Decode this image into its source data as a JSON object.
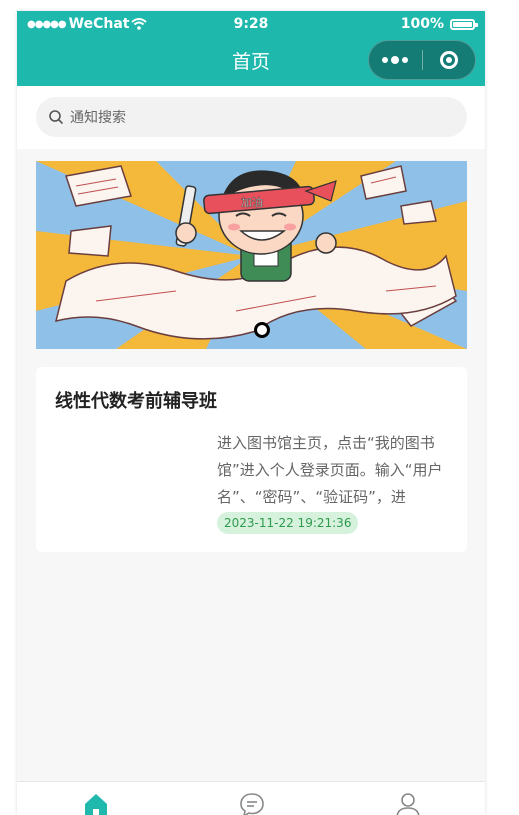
{
  "status_bar": {
    "carrier": "WeChat",
    "time": "9:28",
    "battery": "100%"
  },
  "nav": {
    "title": "首页"
  },
  "search": {
    "placeholder": "通知搜索"
  },
  "banner": {
    "text": "加油"
  },
  "card": {
    "title": "线性代数考前辅导班",
    "description": "进入图书馆主页，点击“我的图书馆”进入个人登录页面。输入“用户名”、“密码”、“验证码”，进",
    "date": "2023-11-22 19:21:36"
  },
  "tabbar": {
    "items": [
      "home-icon",
      "message-icon",
      "user-icon"
    ]
  },
  "colors": {
    "primary": "#1fb8ad",
    "date_text": "#2f9a4e",
    "date_bg": "#d6f2dc"
  }
}
